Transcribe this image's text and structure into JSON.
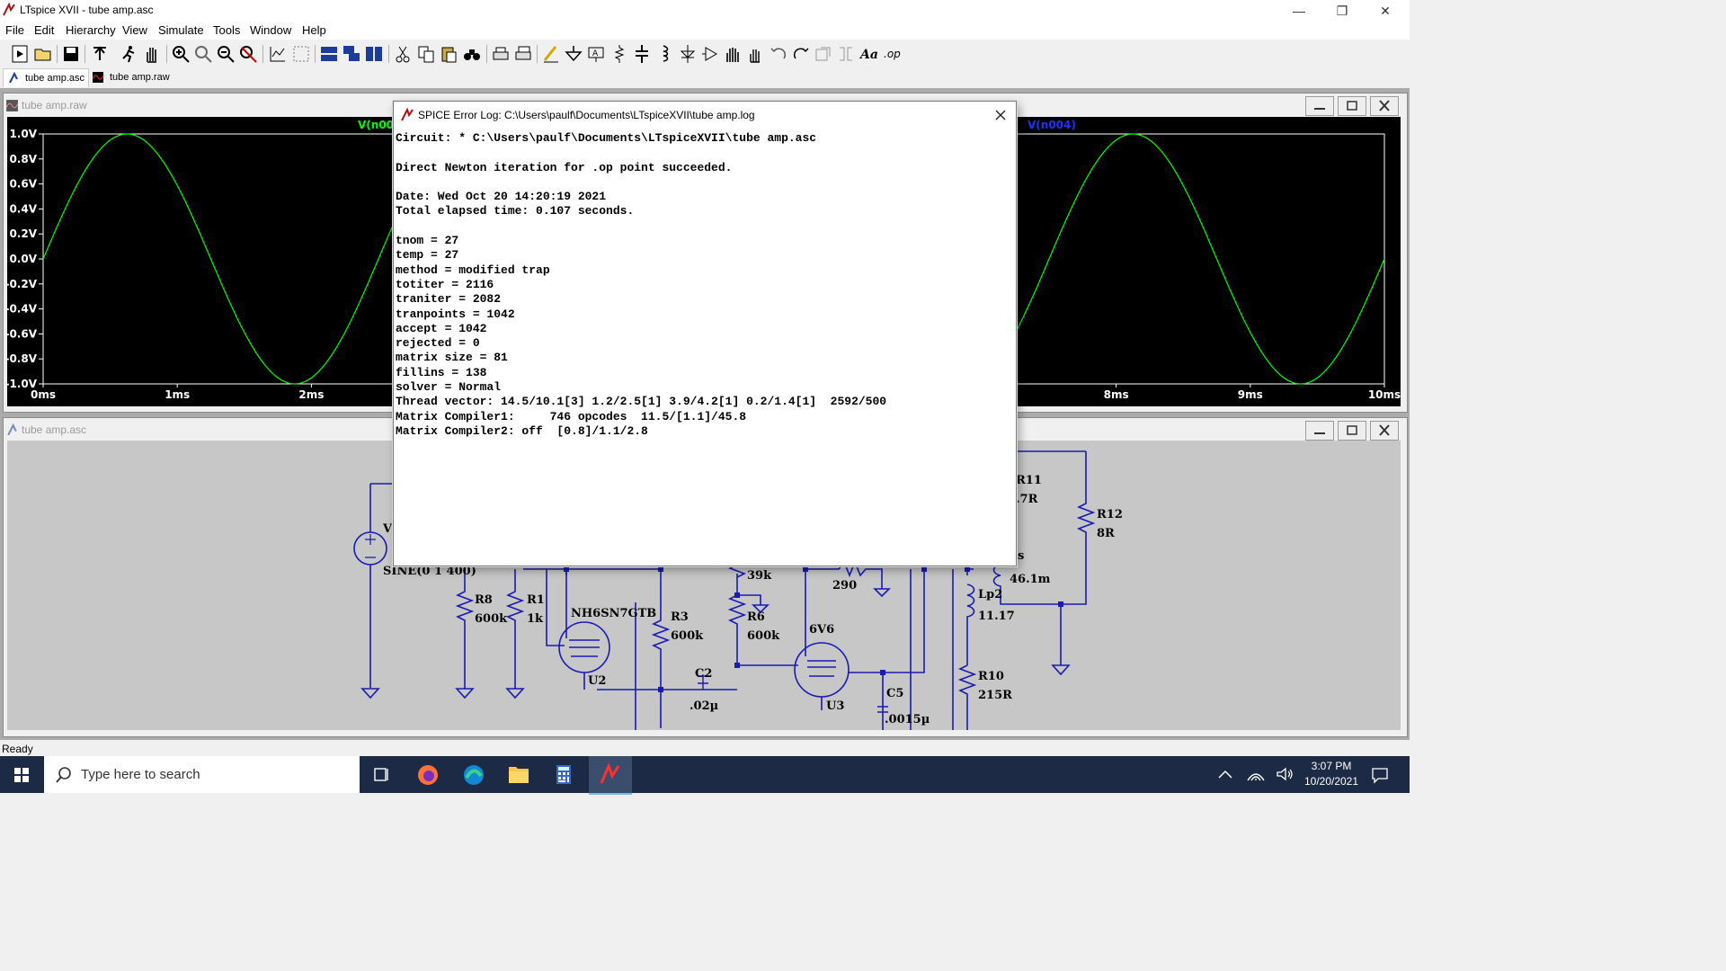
{
  "window": {
    "title": "LTspice XVII - tube amp.asc",
    "min_glyph": "—",
    "max_glyph": "❐",
    "close_glyph": "✕"
  },
  "menu": [
    "File",
    "Edit",
    "Hierarchy",
    "View",
    "Simulate",
    "Tools",
    "Window",
    "Help"
  ],
  "tabs": [
    {
      "label": "tube amp.asc"
    },
    {
      "label": "tube amp.raw"
    }
  ],
  "plot_window": {
    "title": "tube amp.raw",
    "trace_left": "V(n00",
    "trace_right": "V(n004)"
  },
  "schematic_window": {
    "title": "tube amp.asc"
  },
  "chart_data": {
    "type": "line",
    "series": [
      {
        "name": "V(n004)",
        "function": "sin(2*pi*400*t)",
        "amplitude": 1,
        "frequency_hz": 400,
        "color": "#00ff00"
      }
    ],
    "yticks": [
      "1.0V",
      "0.8V",
      "0.6V",
      "0.4V",
      "0.2V",
      "0.0V",
      "-0.2V",
      "-0.4V",
      "-0.6V",
      "-0.8V",
      "-1.0V"
    ],
    "xticks_visible": [
      "0ms",
      "1ms",
      "2ms",
      "8ms",
      "9ms",
      "10ms"
    ],
    "ylim": [
      -1.0,
      1.0
    ],
    "xlim_ms": [
      0,
      10
    ],
    "grid": false,
    "background": "#000000"
  },
  "schematic_labels": {
    "v_source": "V",
    "sine": "SINE(0 1 400)",
    "r8": "R8",
    "r8v": "600k",
    "r1": "R1",
    "r1v": "1k",
    "u2m": "NH6SN7GTB",
    "u2": "U2",
    "r3": "R3",
    "r3v": "600k",
    "c2": "C2",
    "c2v": ".02µ",
    "r6v1": "39k",
    "r6": "R6",
    "r6v": "600k",
    "r290": "290",
    "u3m": "6V6",
    "u3": "U3",
    "c5": "C5",
    "c5v": ".0015µ",
    "r11": "R11",
    "r11v": ".7R",
    "ls": "s",
    "lsv": "46.1m",
    "lp2": "Lp2",
    "lp2v": "11.17",
    "r10": "R10",
    "r10v": "215R",
    "r12": "R12",
    "r12v": "8R"
  },
  "dialog": {
    "title": "SPICE Error Log: C:\\Users\\paulf\\Documents\\LTspiceXVII\\tube amp.log",
    "lines": [
      "Circuit: * C:\\Users\\paulf\\Documents\\LTspiceXVII\\tube amp.asc",
      "",
      "Direct Newton iteration for .op point succeeded.",
      "",
      "Date: Wed Oct 20 14:20:19 2021",
      "Total elapsed time: 0.107 seconds.",
      "",
      "tnom = 27",
      "temp = 27",
      "method = modified trap",
      "totiter = 2116",
      "traniter = 2082",
      "tranpoints = 1042",
      "accept = 1042",
      "rejected = 0",
      "matrix size = 81",
      "fillins = 138",
      "solver = Normal",
      "Thread vector: 14.5/10.1[3] 1.2/2.5[1] 3.9/4.2[1] 0.2/1.4[1]  2592/500",
      "Matrix Compiler1:     746 opcodes  11.5/[1.1]/45.8",
      "Matrix Compiler2: off  [0.8]/1.1/2.8"
    ]
  },
  "status": {
    "text": "Ready"
  },
  "taskbar": {
    "search_placeholder": "Type here to search",
    "time": "3:07 PM",
    "date": "10/20/2021"
  }
}
